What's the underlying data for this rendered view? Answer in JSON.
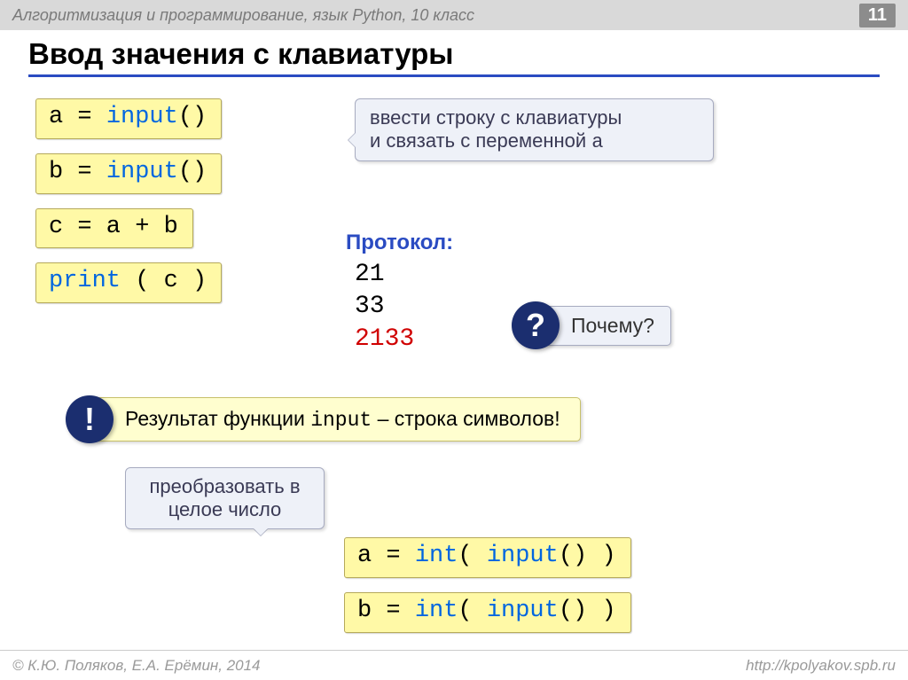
{
  "header": {
    "course": "Алгоритмизация и программирование, язык Python, 10 класс",
    "page": "11"
  },
  "title": "Ввод значения с клавиатуры",
  "code": {
    "line1_a": "a = ",
    "line1_b": "input",
    "line1_c": "()",
    "line2_a": "b = ",
    "line2_b": "input",
    "line2_c": "()",
    "line3": "c = a + b",
    "line4_a": "print",
    "line4_b": " ( c )",
    "int1_a": "a = ",
    "int1_b": "int",
    "int1_c": "( ",
    "int1_d": "input",
    "int1_e": "() )",
    "int2_a": "b = ",
    "int2_b": "int",
    "int2_c": "( ",
    "int2_d": "input",
    "int2_e": "() )"
  },
  "callouts": {
    "input_line1": "ввести строку с клавиатуры",
    "input_line2_a": "и связать с переменной ",
    "input_line2_b": "a",
    "convert_line1": "преобразовать в",
    "convert_line2": "целое число",
    "why": "Почему?",
    "question_mark": "?",
    "excl_mark": "!"
  },
  "protocol": {
    "label": "Протокол:",
    "v1": "21",
    "v2": "33",
    "v3": "2133"
  },
  "result": {
    "t1": "Результат функции ",
    "t2": "input",
    "t3": " – строка символов!"
  },
  "footer": {
    "left": "© К.Ю. Поляков, Е.А. Ерёмин, 2014",
    "right": "http://kpolyakov.spb.ru"
  }
}
